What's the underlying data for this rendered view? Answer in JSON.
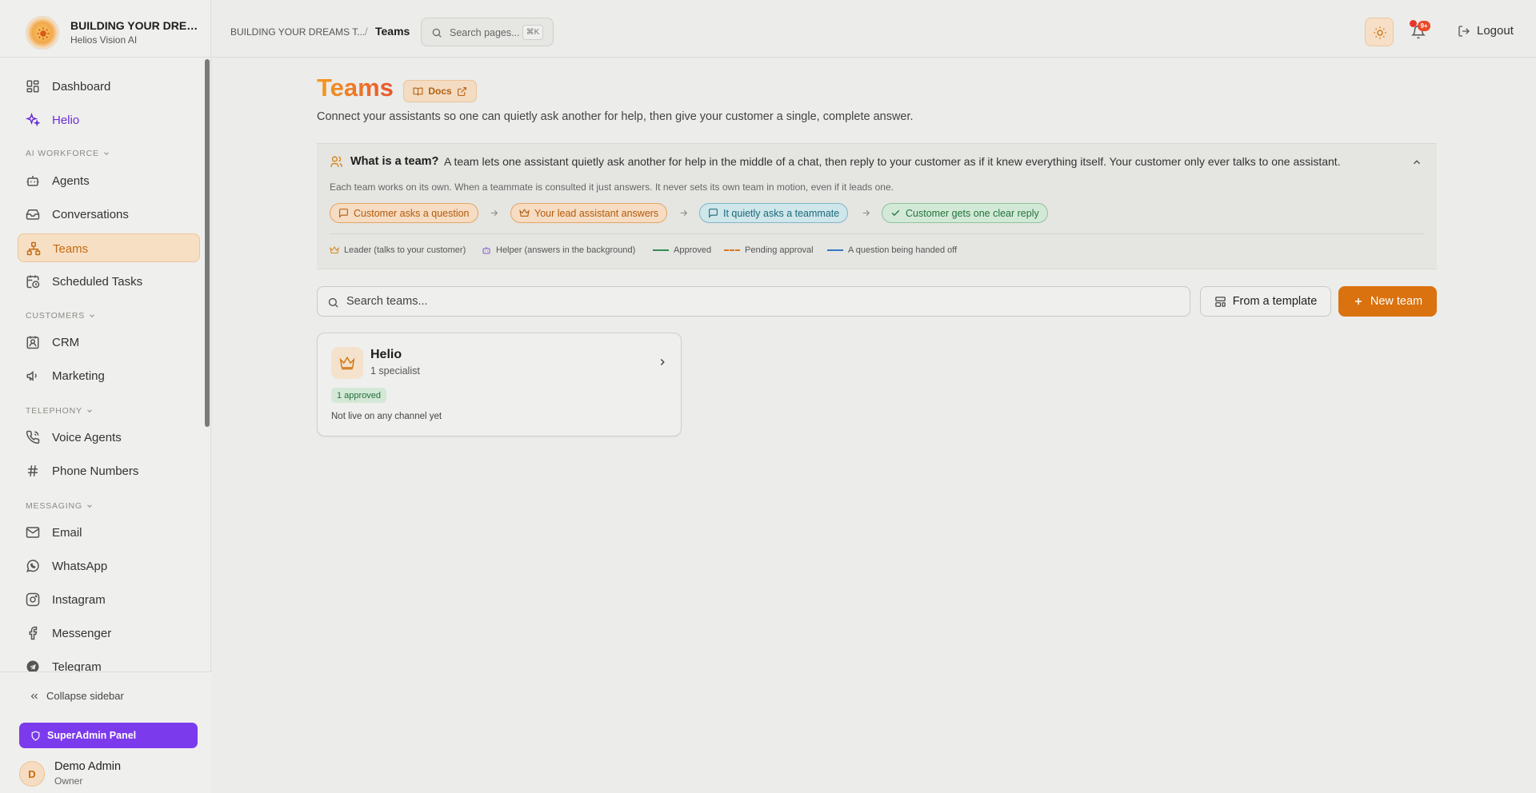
{
  "brand": {
    "title": "BUILDING YOUR DREAMS TOGETHER",
    "subtitle": "Helios Vision AI"
  },
  "sidebar": {
    "items": [
      {
        "label": "Dashboard",
        "icon": "dashboard-icon"
      },
      {
        "label": "Helio",
        "icon": "sparkle-icon"
      },
      {
        "label": "Agents",
        "icon": "bot-icon"
      },
      {
        "label": "Conversations",
        "icon": "inbox-icon"
      },
      {
        "label": "Teams",
        "icon": "network-icon",
        "active": true
      },
      {
        "label": "Scheduled Tasks",
        "icon": "calendar-clock-icon"
      },
      {
        "label": "CRM",
        "icon": "contact-icon"
      },
      {
        "label": "Marketing",
        "icon": "megaphone-icon"
      },
      {
        "label": "Voice Agents",
        "icon": "phone-icon"
      },
      {
        "label": "Phone Numbers",
        "icon": "hash-icon"
      },
      {
        "label": "Email",
        "icon": "mail-icon"
      },
      {
        "label": "WhatsApp",
        "icon": "whatsapp-icon"
      },
      {
        "label": "Instagram",
        "icon": "instagram-icon"
      },
      {
        "label": "Messenger",
        "icon": "facebook-icon"
      },
      {
        "label": "Telegram",
        "icon": "telegram-icon"
      }
    ],
    "sections": {
      "ai_workforce": "AI WORKFORCE",
      "customers": "CUSTOMERS",
      "telephony": "TELEPHONY",
      "messaging": "MESSAGING"
    },
    "collapse_label": "Collapse sidebar",
    "superadmin_label": "SuperAdmin Panel",
    "user": {
      "initial": "D",
      "name": "Demo Admin",
      "role": "Owner"
    }
  },
  "header": {
    "breadcrumb_parent": "BUILDING YOUR DREAMS T...",
    "breadcrumb_sep": "/",
    "breadcrumb_current": "Teams",
    "search_placeholder": "Search pages...",
    "search_shortcut": "⌘K",
    "notification_badge": "9+",
    "logout_label": "Logout"
  },
  "page": {
    "title": "Teams",
    "docs_label": "Docs",
    "description": "Connect your assistants so one can quietly ask another for help, then give your customer a single, complete answer."
  },
  "info": {
    "question": "What is a team?",
    "answer": "A team lets one assistant quietly ask another for help in the middle of a chat, then reply to your customer as if it knew everything itself. Your customer only ever talks to one assistant.",
    "note": "Each team works on its own. When a teammate is consulted it just answers. It never sets its own team in motion, even if it leads one.",
    "flow": [
      "Customer asks a question",
      "Your lead assistant answers",
      "It quietly asks a teammate",
      "Customer gets one clear reply"
    ],
    "legend": [
      "Leader (talks to your customer)",
      "Helper (answers in the background)",
      "Approved",
      "Pending approval",
      "A question being handed off"
    ]
  },
  "toolbar": {
    "search_placeholder": "Search teams...",
    "template_label": "From a template",
    "new_label": "New team"
  },
  "teams": [
    {
      "name": "Helio",
      "specialists": "1 specialist",
      "badge": "1 approved",
      "status": "Not live on any channel yet"
    }
  ],
  "colors": {
    "accent": "#d9720f",
    "superadmin": "#7c3aed",
    "helio": "#6b2fd6",
    "approved": "#2f8f4e",
    "pending": "#d9771e",
    "handoff": "#2f7bc0"
  }
}
